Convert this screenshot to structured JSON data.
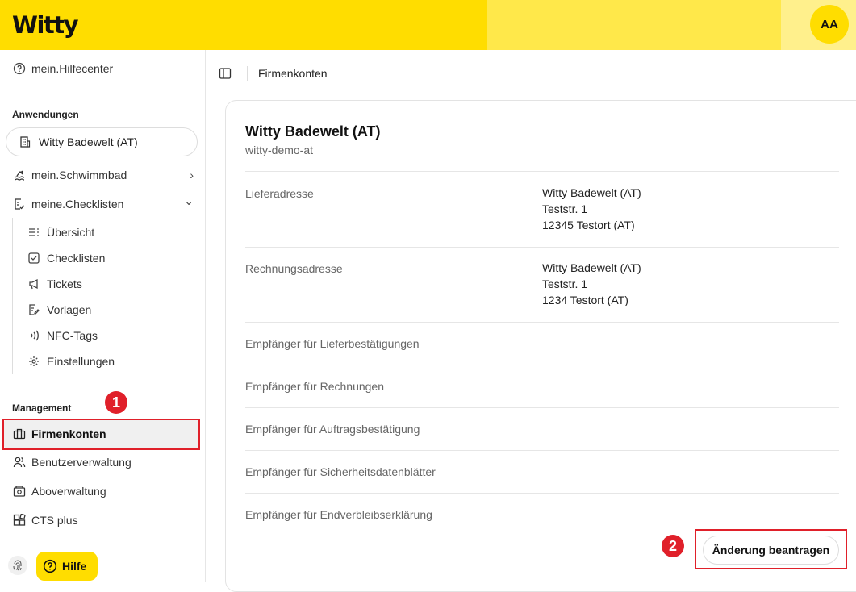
{
  "header": {
    "logo": "Witty",
    "avatar_initials": "AA"
  },
  "sidebar": {
    "help_center": "mein.Hilfecenter",
    "applications_label": "Anwendungen",
    "current_app": "Witty Badewelt (AT)",
    "nav": [
      {
        "label": "mein.Schwimmbad",
        "icon": "pool-icon",
        "chevron": "›"
      },
      {
        "label": "meine.Checklisten",
        "icon": "checklist-icon",
        "chevron": "⌄"
      }
    ],
    "sub_items": [
      {
        "label": "Übersicht",
        "icon": "list-icon"
      },
      {
        "label": "Checklisten",
        "icon": "checkbox-icon"
      },
      {
        "label": "Tickets",
        "icon": "megaphone-icon"
      },
      {
        "label": "Vorlagen",
        "icon": "template-icon"
      },
      {
        "label": "NFC-Tags",
        "icon": "nfc-icon"
      },
      {
        "label": "Einstellungen",
        "icon": "gear-icon"
      }
    ],
    "management_label": "Management",
    "management_items": [
      {
        "label": "Firmenkonten",
        "icon": "briefcase-icon",
        "active": true
      },
      {
        "label": "Benutzerverwaltung",
        "icon": "users-icon"
      },
      {
        "label": "Aboverwaltung",
        "icon": "subscription-icon"
      },
      {
        "label": "CTS plus",
        "icon": "blocks-icon"
      }
    ],
    "help_button": "Hilfe"
  },
  "breadcrumb": {
    "current": "Firmenkonten"
  },
  "account": {
    "name": "Witty Badewelt (AT)",
    "slug": "witty-demo-at",
    "delivery_label": "Lieferadresse",
    "delivery_lines": [
      "Witty Badewelt (AT)",
      "Teststr. 1",
      "12345 Testort (AT)"
    ],
    "billing_label": "Rechnungsadresse",
    "billing_lines": [
      "Witty Badewelt (AT)",
      "Teststr. 1",
      "1234 Testort (AT)"
    ],
    "recipients": [
      "Empfänger für Lieferbestätigungen",
      "Empfänger für Rechnungen",
      "Empfänger für Auftragsbestätigung",
      "Empfänger für Sicherheitsdatenblätter",
      "Empfänger für Endverbleibserklärung"
    ],
    "action_button": "Änderung beantragen"
  },
  "annotations": {
    "marker_1": "1",
    "marker_2": "2"
  },
  "colors": {
    "brand_yellow": "#ffdd00",
    "highlight_red": "#e0202a"
  }
}
